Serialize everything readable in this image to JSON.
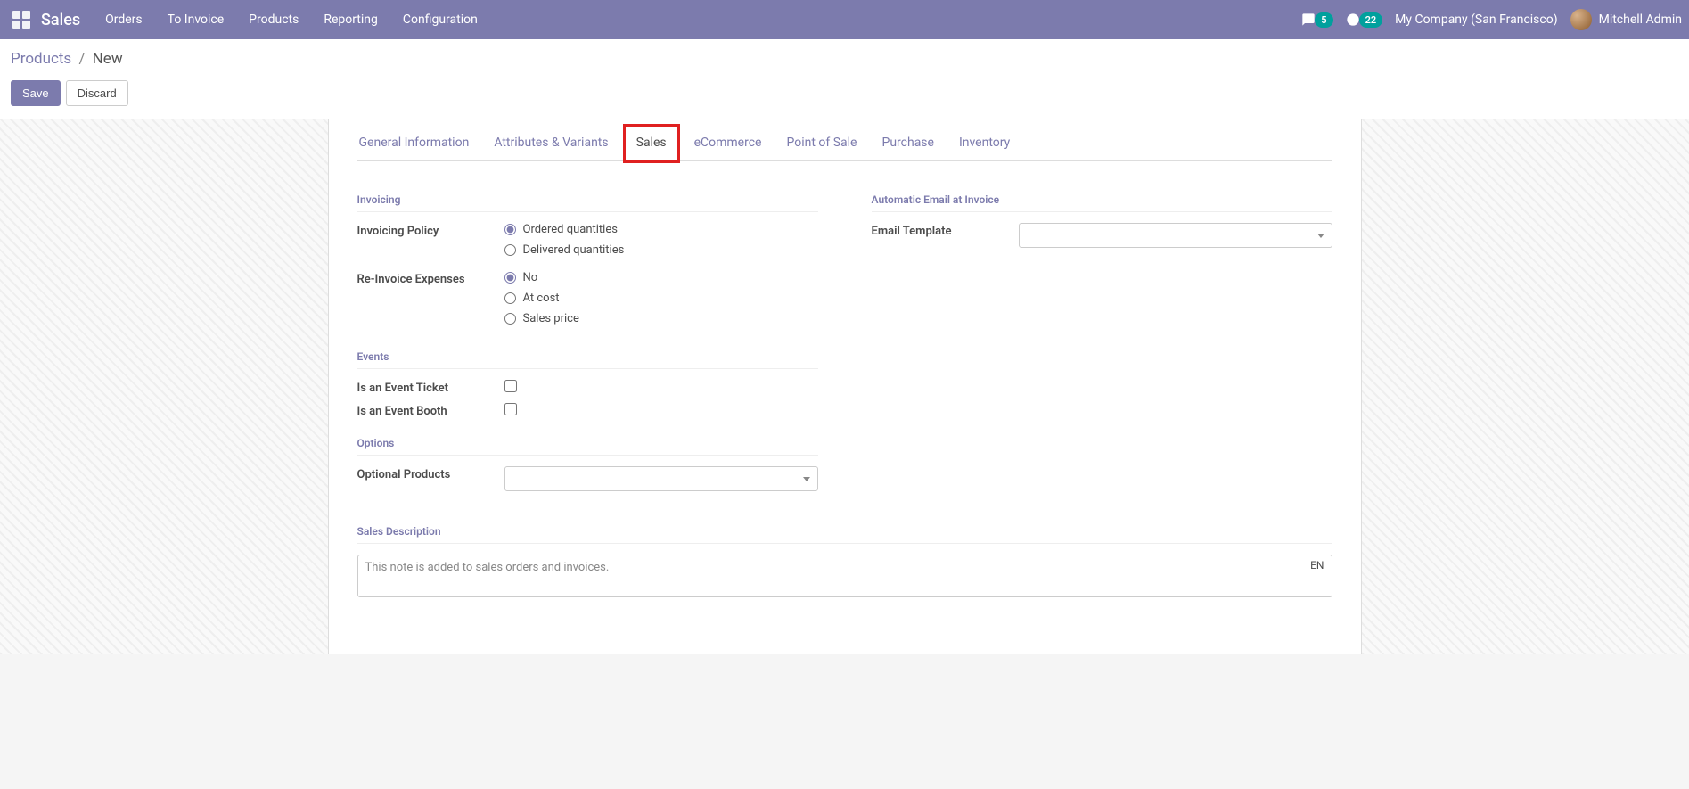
{
  "topbar": {
    "brand": "Sales",
    "menu": [
      "Orders",
      "To Invoice",
      "Products",
      "Reporting",
      "Configuration"
    ],
    "messages_count": "5",
    "activities_count": "22",
    "company": "My Company (San Francisco)",
    "user": "Mitchell Admin"
  },
  "breadcrumb": {
    "parent": "Products",
    "current": "New"
  },
  "actions": {
    "save": "Save",
    "discard": "Discard"
  },
  "tabs": [
    "General Information",
    "Attributes & Variants",
    "Sales",
    "eCommerce",
    "Point of Sale",
    "Purchase",
    "Inventory"
  ],
  "active_tab_index": 2,
  "sections": {
    "invoicing": {
      "title": "Invoicing",
      "invoicing_policy": {
        "label": "Invoicing Policy",
        "options": [
          "Ordered quantities",
          "Delivered quantities"
        ],
        "selected": "Ordered quantities"
      },
      "re_invoice": {
        "label": "Re-Invoice Expenses",
        "options": [
          "No",
          "At cost",
          "Sales price"
        ],
        "selected": "No"
      }
    },
    "events": {
      "title": "Events",
      "is_ticket": {
        "label": "Is an Event Ticket",
        "checked": false
      },
      "is_booth": {
        "label": "Is an Event Booth",
        "checked": false
      }
    },
    "options": {
      "title": "Options",
      "optional_products": {
        "label": "Optional Products",
        "value": ""
      }
    },
    "auto_email": {
      "title": "Automatic Email at Invoice",
      "email_template": {
        "label": "Email Template",
        "value": ""
      }
    },
    "sales_desc": {
      "title": "Sales Description",
      "placeholder": "This note is added to sales orders and invoices.",
      "lang": "EN",
      "value": ""
    }
  }
}
